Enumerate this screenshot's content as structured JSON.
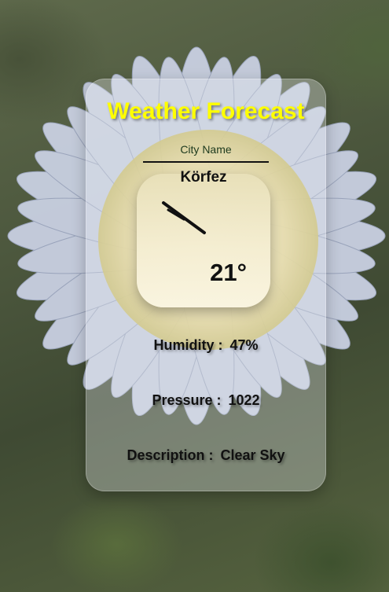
{
  "app": {
    "title": "Weather Forecast"
  },
  "search": {
    "placeholder": "City Name",
    "value": ""
  },
  "weather": {
    "city": "Körfez",
    "icon": "clear-sky-icon",
    "temperature": "21°",
    "humidity_label": "Humidity :",
    "humidity_value": "47%",
    "pressure_label": "Pressure :",
    "pressure_value": "1022",
    "description_label": "Description :",
    "description_value": "Clear Sky"
  },
  "colors": {
    "title": "#ffff00",
    "text": "#111111"
  }
}
